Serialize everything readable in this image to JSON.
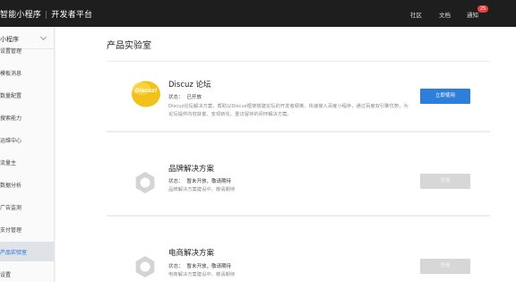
{
  "header": {
    "brand": "智能小程序",
    "platform": "开发者平台",
    "nav": [
      "社区",
      "文档",
      "通知"
    ],
    "notify_count": "25",
    "colors": {
      "bar": "#1e1e1e",
      "badge": "#e64340"
    }
  },
  "sidebar": {
    "title": "小程序",
    "items": [
      {
        "label": "设置管理"
      },
      {
        "label": "模板消息"
      },
      {
        "label": "数量配置"
      },
      {
        "label": "搜索能力"
      },
      {
        "label": "运维中心"
      },
      {
        "label": "流量主"
      },
      {
        "label": "数据分析"
      },
      {
        "label": "广告监测"
      },
      {
        "label": "支付管理"
      },
      {
        "label": "产品实验室"
      },
      {
        "label": "设置"
      }
    ],
    "active_index": 9
  },
  "main": {
    "title": "产品实验室",
    "cards": [
      {
        "title": "Discuz 论坛",
        "status_key": "状态：",
        "status_value": "已开放",
        "desc": "Discuz论坛解决方案，帮助以Discuz框架搭建论坛的开发者便携、快速接入百度小程序，通过百度双引擎优势，为论坛提供内容获客、变现转化、重访留存的闭环解决方案。",
        "button": "立即使用",
        "icon": "discuz-logo",
        "logo_text": "Discuz!"
      },
      {
        "title": "品牌解决方案",
        "status_key": "状态：",
        "status_value": "暂未开放，敬请期待",
        "desc": "品牌解决方案建设中，敬请期待",
        "button": "查看",
        "icon": "gear-icon"
      },
      {
        "title": "电商解决方案",
        "status_key": "状态：",
        "status_value": "暂未开放，敬请期待",
        "desc": "电商解决方案建设中，敬请期待",
        "button": "查看",
        "icon": "gear-icon"
      }
    ],
    "colors": {
      "primary": "#2d7fd9",
      "disabled": "#d7d7d7",
      "discuz_yellow": "#f2c21b"
    }
  }
}
